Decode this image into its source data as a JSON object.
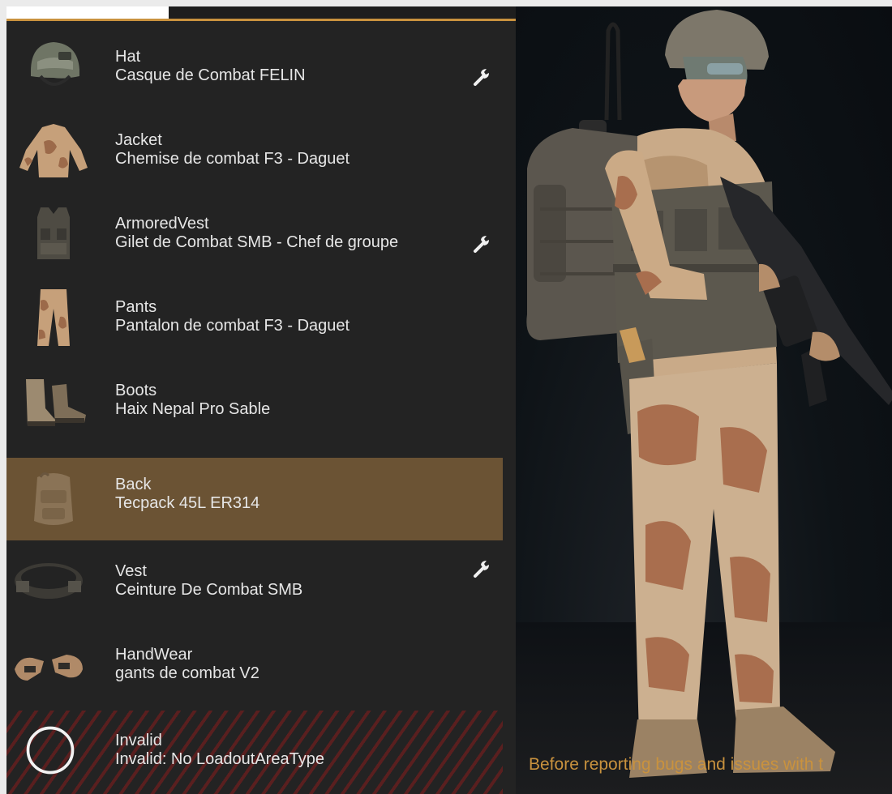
{
  "slots": [
    {
      "category": "Hat",
      "item": "Casque de Combat FELIN",
      "icon": "helmet-icon",
      "has_wrench": true
    },
    {
      "category": "Jacket",
      "item": "Chemise de combat F3 - Daguet",
      "icon": "jacket-icon",
      "has_wrench": false
    },
    {
      "category": "ArmoredVest",
      "item": "Gilet de Combat SMB - Chef de groupe",
      "icon": "armored-vest-icon",
      "has_wrench": true
    },
    {
      "category": "Pants",
      "item": "Pantalon de combat F3 - Daguet",
      "icon": "pants-icon",
      "has_wrench": false
    },
    {
      "category": "Boots",
      "item": "Haix Nepal Pro Sable",
      "icon": "boots-icon",
      "has_wrench": false
    },
    {
      "category": "Back",
      "item": "Tecpack 45L ER314",
      "icon": "backpack-icon",
      "has_wrench": false,
      "selected": true
    },
    {
      "category": "Vest",
      "item": "Ceinture De Combat SMB",
      "icon": "belt-icon",
      "has_wrench": true
    },
    {
      "category": "HandWear",
      "item": "gants de combat V2",
      "icon": "gloves-icon",
      "has_wrench": false
    },
    {
      "category": "Invalid",
      "item": "Invalid: No LoadoutAreaType",
      "icon": "invalid-circle-icon",
      "has_wrench": false,
      "invalid": true
    }
  ],
  "notice": "Before reporting bugs and issues with t",
  "colors": {
    "accent": "#c9923e",
    "panel": "#232323",
    "selected": "#6b5334",
    "invalid_stripe": "#5a1f1f"
  }
}
